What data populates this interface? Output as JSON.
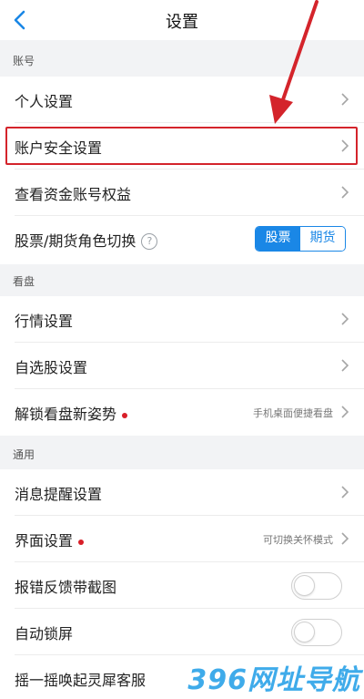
{
  "header": {
    "title": "设置"
  },
  "sections": {
    "account": "账号",
    "market": "看盘",
    "general": "通用"
  },
  "rows": {
    "personal": "个人设置",
    "security": "账户安全设置",
    "funds": "查看资金账号权益",
    "role_switch": "股票/期货角色切换",
    "role_help": "?",
    "role_stock": "股票",
    "role_futures": "期货",
    "quotes": "行情设置",
    "watchlist": "自选股设置",
    "unlock": "解锁看盘新姿势",
    "unlock_hint": "手机桌面便捷看盘",
    "ui": "界面设置",
    "ui_hint": "可切换关怀模式",
    "feedback": "报错反馈带截图",
    "autolock": "自动锁屏",
    "shake": "摇一摇唤起灵犀客服"
  },
  "toggles": {
    "feedback_on": false,
    "autolock_on": false
  },
  "role_selected": "股票",
  "watermark": "396网址导航",
  "colors": {
    "accent": "#1a87e6",
    "highlight": "#d4242b",
    "dot": "#d81e28"
  }
}
